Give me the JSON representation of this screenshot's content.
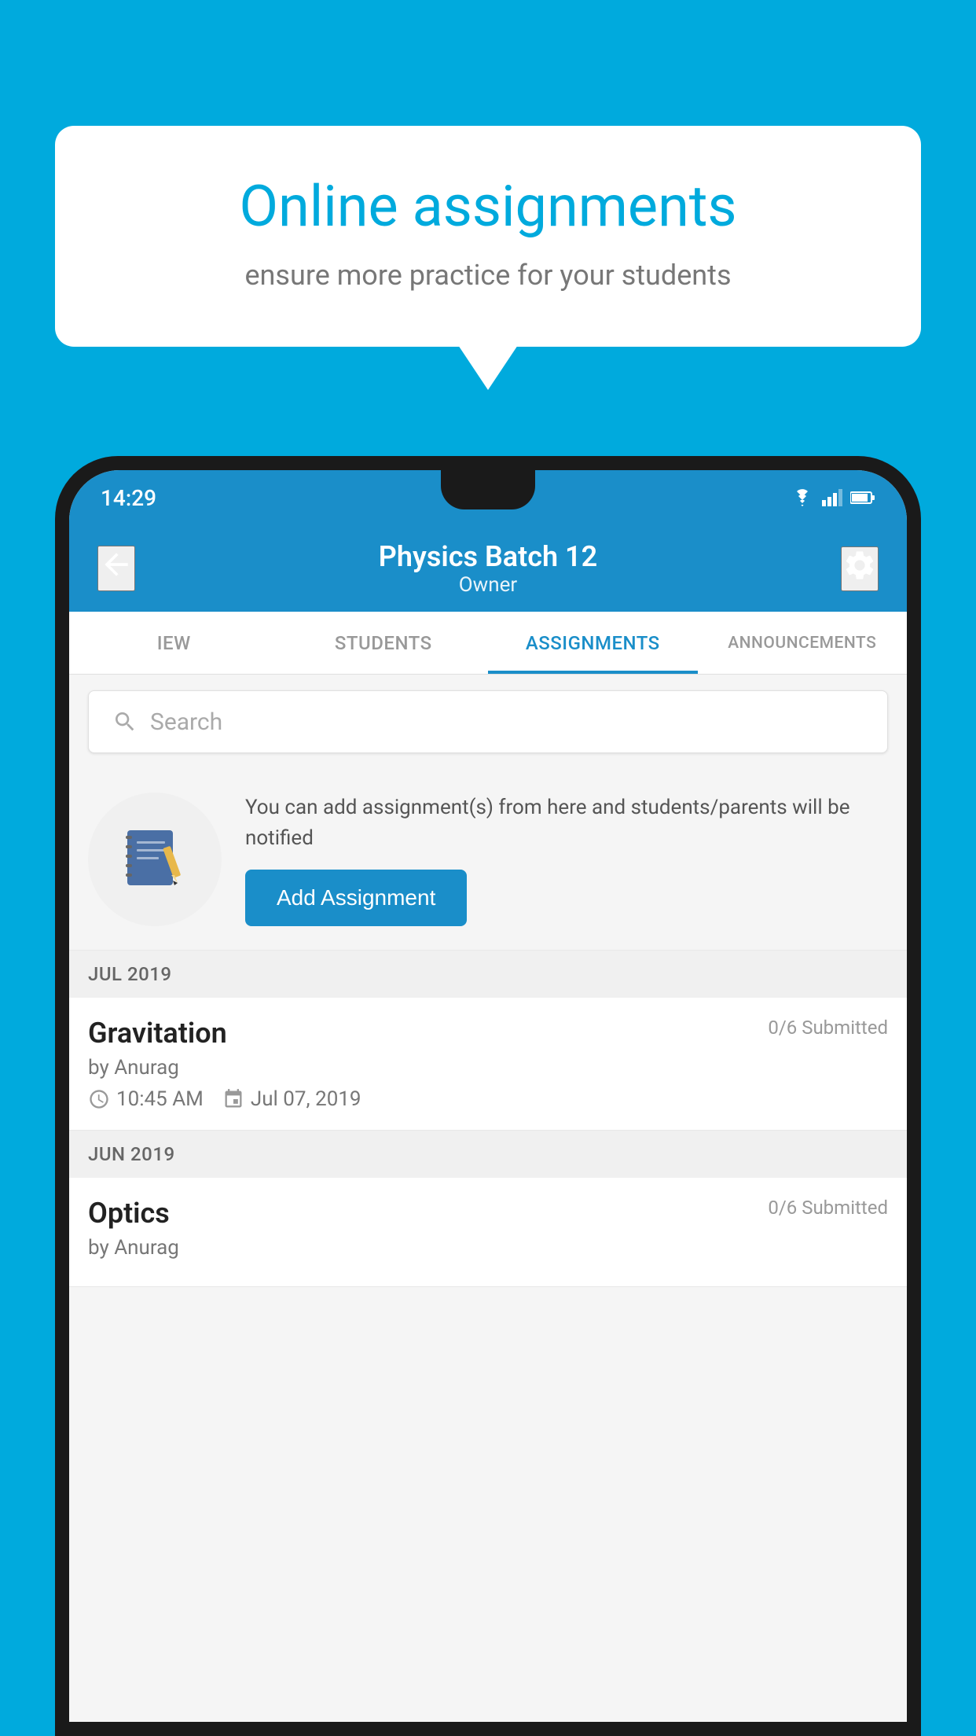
{
  "background_color": "#00AADD",
  "speech_bubble": {
    "title": "Online assignments",
    "subtitle": "ensure more practice for your students"
  },
  "status_bar": {
    "time": "14:29",
    "icons": [
      "wifi",
      "signal",
      "battery"
    ]
  },
  "app_bar": {
    "title": "Physics Batch 12",
    "subtitle": "Owner",
    "back_label": "←",
    "settings_label": "⚙"
  },
  "tabs": [
    {
      "label": "IEW",
      "active": false
    },
    {
      "label": "STUDENTS",
      "active": false
    },
    {
      "label": "ASSIGNMENTS",
      "active": true
    },
    {
      "label": "ANNOUNCEMENTS",
      "active": false
    }
  ],
  "search": {
    "placeholder": "Search"
  },
  "promo": {
    "description": "You can add assignment(s) from here and students/parents will be notified",
    "button_label": "Add Assignment"
  },
  "sections": [
    {
      "month": "JUL 2019",
      "assignments": [
        {
          "title": "Gravitation",
          "submitted": "0/6 Submitted",
          "author": "by Anurag",
          "time": "10:45 AM",
          "date": "Jul 07, 2019"
        }
      ]
    },
    {
      "month": "JUN 2019",
      "assignments": [
        {
          "title": "Optics",
          "submitted": "0/6 Submitted",
          "author": "by Anurag",
          "time": "",
          "date": ""
        }
      ]
    }
  ]
}
